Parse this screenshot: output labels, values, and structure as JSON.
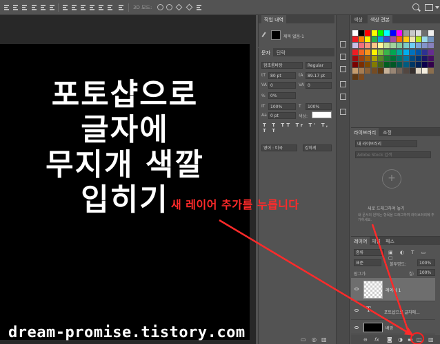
{
  "options_bar": {
    "mode_3d": "3D 모드:"
  },
  "document": {
    "title_lines": [
      "포토샵으로",
      "글자에",
      "무지개 색깔",
      "입히기"
    ],
    "watermark": "dream-promise.tistory.com"
  },
  "history_panel": {
    "tab": "작업 내역",
    "item": "제목 없음-1"
  },
  "character_panel": {
    "tabs": [
      "문자",
      "단락"
    ],
    "font_family": "함초롬바탕",
    "font_style": "Regular",
    "font_size": "80 pt",
    "leading": "89.17 pt",
    "kerning": "0",
    "tracking": "0",
    "tsume": "0%",
    "vertical_scale": "100%",
    "horizontal_scale": "100%",
    "baseline_shift": "0 pt",
    "color_label": "색상:",
    "language": "영어 : 미국",
    "antialias": "강하게",
    "style_buttons": "T T TT Tr T' T, T T"
  },
  "swatches_panel": {
    "tabs": [
      "색상",
      "색상 견본"
    ],
    "colors": [
      "#ffffff",
      "#000000",
      "#ff0000",
      "#ffff00",
      "#00ff00",
      "#00ffff",
      "#0000ff",
      "#ff00ff",
      "#9a9a9a",
      "#c8c8c8",
      "#dedede",
      "#6e6e6e",
      "#f0f0f0",
      "#ee1c24",
      "#ff7f00",
      "#fff200",
      "#22b14c",
      "#00a2e8",
      "#3f48cc",
      "#a349a4",
      "#ff6a00",
      "#ffc90e",
      "#efe4b0",
      "#b5e61d",
      "#99d9ea",
      "#7092be",
      "#c8bfe7",
      "#f26d7d",
      "#f69679",
      "#fdc689",
      "#fff799",
      "#c4df9b",
      "#a2d39c",
      "#82ca9c",
      "#7accc8",
      "#6dcff6",
      "#7da7d9",
      "#8393ca",
      "#8781bd",
      "#ed1c24",
      "#f26522",
      "#f7941d",
      "#fff200",
      "#8dc63f",
      "#39b54a",
      "#00a651",
      "#00a99d",
      "#00aeef",
      "#0072bc",
      "#0054a6",
      "#2e3192",
      "#662d91",
      "#9e0b0f",
      "#a0410d",
      "#a3620a",
      "#aba000",
      "#598527",
      "#197b30",
      "#007236",
      "#00746b",
      "#0076a3",
      "#004a80",
      "#003471",
      "#1b1464",
      "#440e62",
      "#790000",
      "#7b2e00",
      "#7d4900",
      "#827b00",
      "#406618",
      "#005e20",
      "#005826",
      "#005952",
      "#005b7f",
      "#003663",
      "#002157",
      "#0d004c",
      "#32004b",
      "#c69c6d",
      "#a67c52",
      "#8c6239",
      "#754c24",
      "#603913",
      "#c7b299",
      "#998675",
      "#736357",
      "#534741",
      "#362f2d",
      "#e0d6c5",
      "#f5efe0",
      "#8b6f4e",
      "#603913",
      "#7d4a1e"
    ]
  },
  "libraries_panel": {
    "tabs": [
      "라이브러리",
      "조정"
    ],
    "library_name": "내 라이브러리",
    "search_placeholder": "Adobe Stock 검색",
    "hint_title": "새로 드래그하여 놓기",
    "hint_text": "내 문서의 원하는 항목을 드래그하여 라이브러리에 추가하세요."
  },
  "layers_panel": {
    "tabs": [
      "레이어",
      "채널",
      "패스"
    ],
    "filter": "종류",
    "blend_mode": "표준",
    "opacity_label": "불투명도:",
    "opacity": "100%",
    "lock_label": "잠그기:",
    "fill_label": "칠:",
    "fill": "100%",
    "layers": [
      {
        "name": "레이어 1",
        "kind": "pixel",
        "selected": true
      },
      {
        "name": "포토샵으로 글자에...",
        "kind": "text",
        "selected": false
      },
      {
        "name": "배경",
        "kind": "background",
        "selected": false
      }
    ],
    "footer_icons": [
      "link-icon",
      "fx-icon",
      "mask-icon",
      "adjustment-icon",
      "folder-icon",
      "new-layer-icon",
      "trash-icon"
    ]
  },
  "annotation": {
    "text": "새 레이어 추가를 누릅니다",
    "color": "#ff2a2a"
  },
  "colors": {
    "ui_bg": "#535353",
    "panel_header": "#424242",
    "canvas": "#000000",
    "selected_layer": "#6e6e6e"
  }
}
